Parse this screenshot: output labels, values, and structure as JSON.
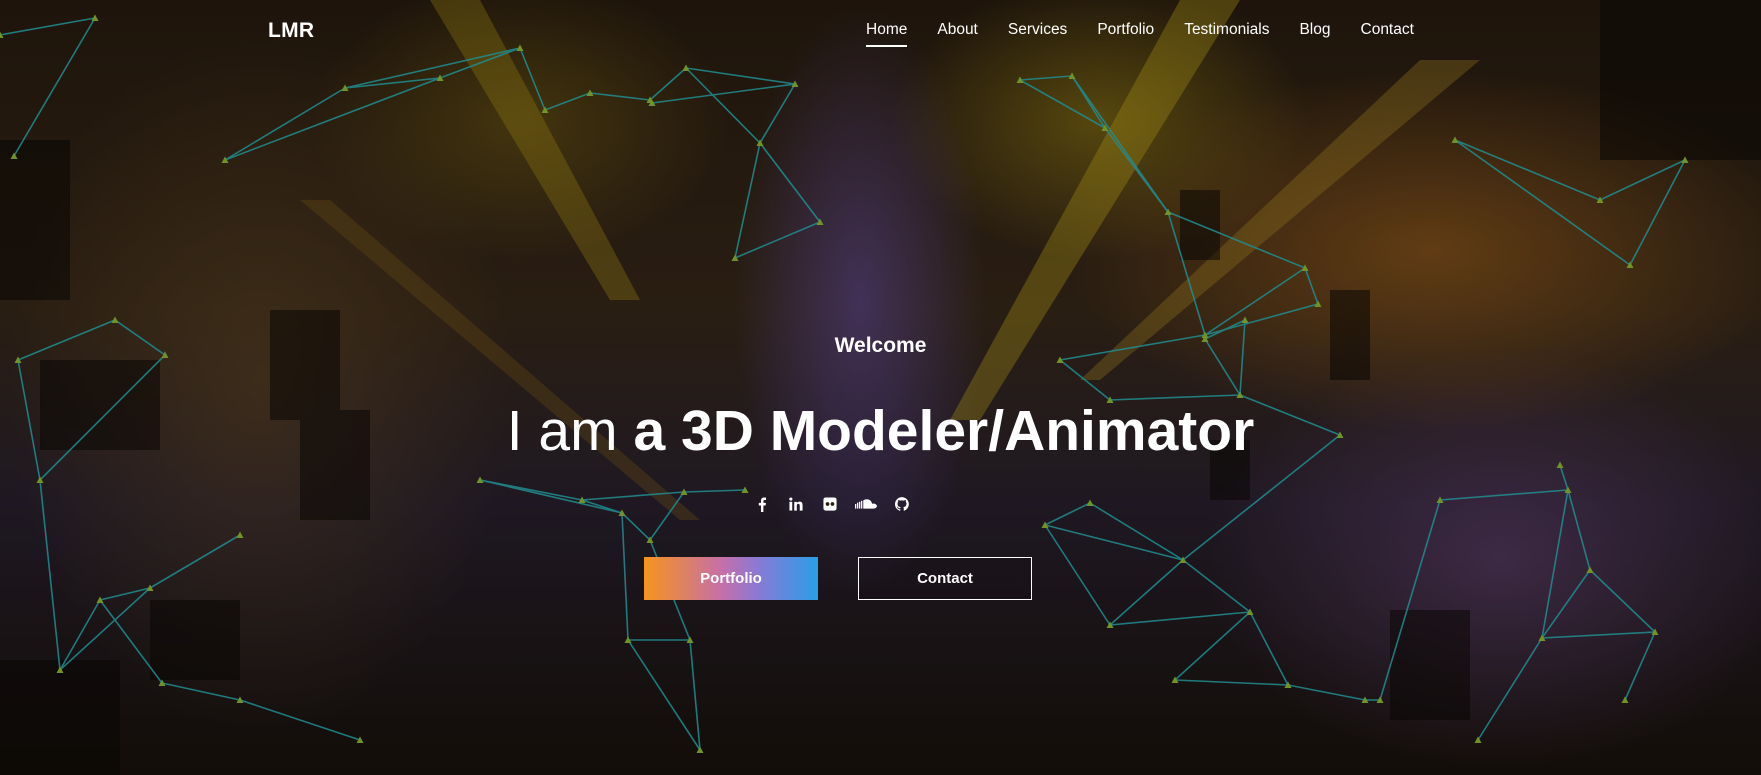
{
  "brand": {
    "name": "LMR"
  },
  "nav": {
    "items": [
      {
        "label": "Home",
        "active": true
      },
      {
        "label": "About"
      },
      {
        "label": "Services"
      },
      {
        "label": "Portfolio"
      },
      {
        "label": "Testimonials"
      },
      {
        "label": "Blog"
      },
      {
        "label": "Contact"
      }
    ]
  },
  "hero": {
    "welcome": "Welcome",
    "headline_lead": "I am",
    "headline_role": "a 3D Modeler/Animator",
    "social_icons": [
      "facebook-icon",
      "linkedin-icon",
      "flickr-icon",
      "soundcloud-icon",
      "github-icon"
    ],
    "buttons": {
      "portfolio": "Portfolio",
      "contact": "Contact"
    }
  },
  "colors": {
    "network_line": "#2ec4c8",
    "network_node": "#9ccc3a",
    "portfolio_gradient_start": "#f7941d",
    "portfolio_gradient_end": "#2a9ee8",
    "text": "#ffffff"
  }
}
